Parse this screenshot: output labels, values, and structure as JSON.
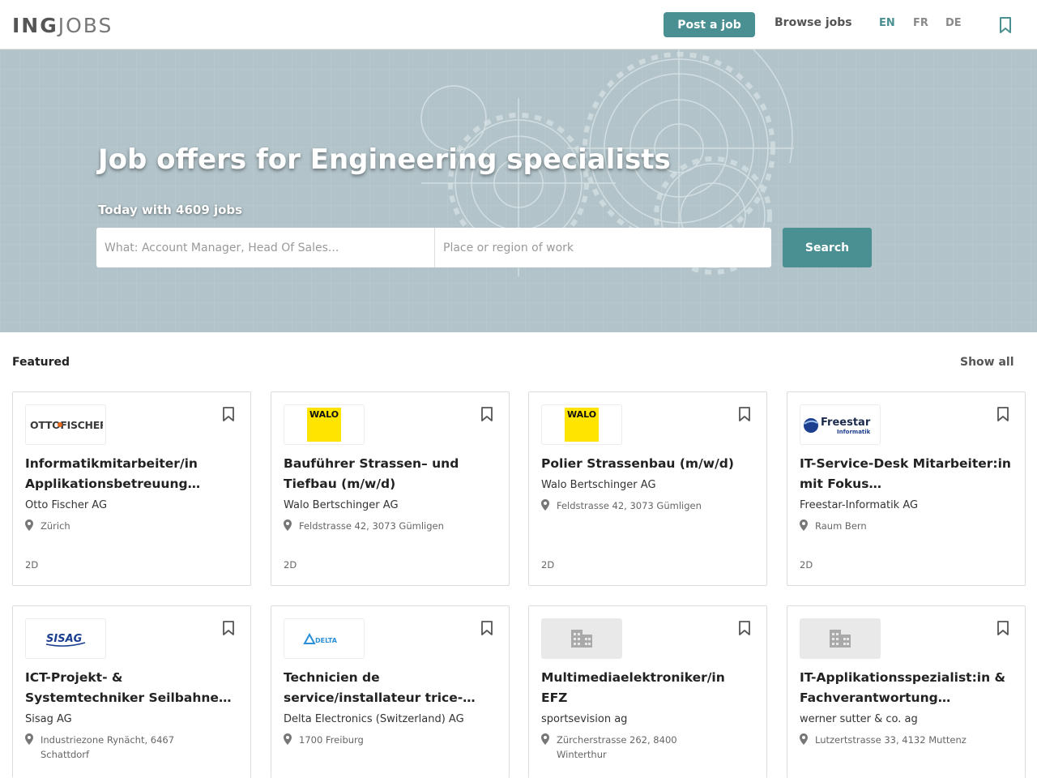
{
  "header": {
    "logo_part1": "ING",
    "logo_part2": "JOBS",
    "post_job": "Post a job",
    "browse_jobs": "Browse jobs",
    "languages": [
      "EN",
      "FR",
      "DE"
    ],
    "active_language": "EN"
  },
  "hero": {
    "title": "Job offers for Engineering specialists",
    "subtitle": "Today with 4609 jobs",
    "what_placeholder": "What: Account Manager, Head Of Sales...",
    "where_placeholder": "Place or region of work",
    "search_label": "Search"
  },
  "featured": {
    "title": "Featured",
    "show_all": "Show all",
    "cards": [
      {
        "logo_text": "OTTOFISCHER",
        "title": "Informatikmitarbeiter/in Applikationsbetreuung…",
        "company": "Otto Fischer AG",
        "location": "Zürich",
        "date": "2D"
      },
      {
        "logo_text": "WALO",
        "title": "Bauführer Strassen– und Tiefbau (m/w/d)",
        "company": "Walo Bertschinger AG",
        "location": "Feldstrasse 42, 3073 Gümligen",
        "date": "2D"
      },
      {
        "logo_text": "WALO",
        "title": "Polier Strassenbau (m/w/d)",
        "company": "Walo Bertschinger AG",
        "location": "Feldstrasse 42, 3073 Gümligen",
        "date": "2D"
      },
      {
        "logo_text": "Freestar",
        "logo_subtext": "Informatik",
        "title": "IT-Service-Desk Mitarbeiter:in mit Fokus…",
        "company": "Freestar-Informatik AG",
        "location": "Raum Bern",
        "date": "2D"
      },
      {
        "logo_text": "SISAG",
        "title": "ICT-Projekt- & Systemtechniker Seilbahne…",
        "company": "Sisag AG",
        "location": "Industriezone Rynächt, 6467 Schattdorf"
      },
      {
        "logo_text": "DELTA",
        "title": "Technicien de service/installateur trice-…",
        "company": "Delta Electronics (Switzerland) AG",
        "location": "1700 Freiburg"
      },
      {
        "logo_icon": "building-icon",
        "title": "Multimediaelektroniker/in EFZ",
        "company": "sportsevision ag",
        "location": "Zürcherstrasse 262, 8400 Winterthur"
      },
      {
        "logo_icon": "building-icon",
        "title": "IT-Applikationsspezialist:in & Fachverantwortung…",
        "company": "werner sutter & co. ag",
        "location": "Lutzertstrasse 33, 4132 Muttenz"
      }
    ]
  },
  "colors": {
    "accent": "#4a9092",
    "hero_bg": "#b5c7cd",
    "walo_yellow": "#ffe400"
  }
}
